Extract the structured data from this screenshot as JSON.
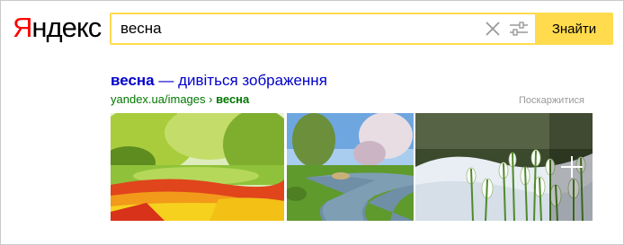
{
  "header": {
    "logo_first": "Я",
    "logo_rest": "ндекс"
  },
  "search": {
    "query": "весна",
    "submit_label": "Знайти"
  },
  "result": {
    "title_query": "весна",
    "title_rest": " — дивіться зображення",
    "url_path": "yandex.ua/images",
    "url_separator": " › ",
    "url_query": "весна",
    "complain_label": "Поскаржитися"
  },
  "images": [
    {
      "name": "tulip-garden-image"
    },
    {
      "name": "spring-river-image"
    },
    {
      "name": "snowdrops-image"
    }
  ],
  "colors": {
    "accent": "#ffdb4d",
    "link": "#0000cc",
    "url": "#007700"
  }
}
